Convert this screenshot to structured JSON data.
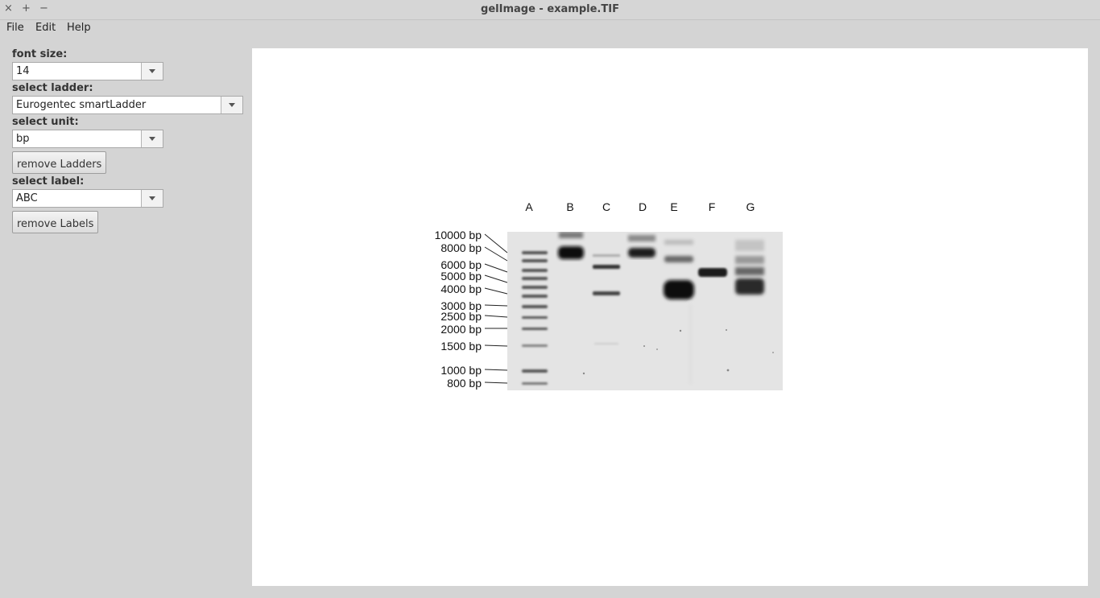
{
  "window": {
    "title": "gelImage - example.TIF",
    "controls": {
      "close": "×",
      "maximize": "+",
      "minimize": "−"
    }
  },
  "menu": {
    "file": "File",
    "edit": "Edit",
    "help": "Help"
  },
  "panel": {
    "font_size_label": "font size:",
    "font_size_value": "14",
    "ladder_label": "select ladder:",
    "ladder_value": "Eurogentec smartLadder",
    "unit_label": "select unit:",
    "unit_value": "bp",
    "remove_ladders": "remove Ladders",
    "label_label": "select label:",
    "label_value": "ABC",
    "remove_labels": "remove Labels"
  },
  "gel": {
    "lanes": [
      "A",
      "B",
      "C",
      "D",
      "E",
      "F",
      "G"
    ],
    "ladder": [
      "10000 bp",
      "8000 bp",
      "6000 bp",
      "5000 bp",
      "4000 bp",
      "3000 bp",
      "2500 bp",
      "2000 bp",
      "1500 bp",
      "1000 bp",
      "800 bp"
    ]
  }
}
